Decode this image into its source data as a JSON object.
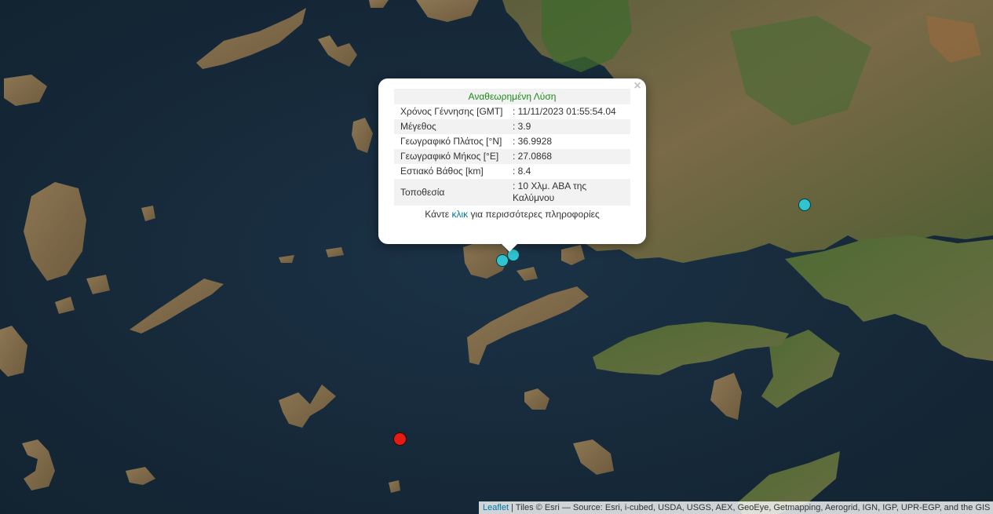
{
  "popup": {
    "heading": "Αναθεωρημένη Λύση",
    "close_symbol": "×",
    "rows": [
      {
        "label": "Χρόνος Γέννησης [GMT]",
        "value": ": 11/11/2023 01:55:54.04"
      },
      {
        "label": "Μέγεθος",
        "value": ": 3.9"
      },
      {
        "label": "Γεωγραφικό Πλάτος [°N]",
        "value": ": 36.9928"
      },
      {
        "label": "Γεωγραφικό Μήκος [°E]",
        "value": ": 27.0868"
      },
      {
        "label": "Εστιακό Βάθος [km]",
        "value": ": 8.4"
      },
      {
        "label": "Τοποθεσία",
        "value": ": 10 Χλμ. ΑΒΑ της Καλύμνου"
      }
    ],
    "footer_prefix": "Κάντε ",
    "footer_link": "κλικ",
    "footer_suffix": " για περισσότερες πληροφορίες"
  },
  "markers": [
    {
      "kind": "earthquake-recent",
      "color": "#2fc4cf"
    },
    {
      "kind": "earthquake-recent",
      "color": "#2fc4cf"
    },
    {
      "kind": "earthquake-recent",
      "color": "#2fc4cf"
    },
    {
      "kind": "earthquake-latest",
      "color": "#e21b14"
    }
  ],
  "attribution": {
    "leaflet_link": "Leaflet",
    "text": " | Tiles © Esri — Source: Esri, i-cubed, USDA, USGS, AEX, GeoEye, Getmapping, Aerogrid, IGN, IGP, UPR-EGP, and the GIS User Community"
  },
  "colors": {
    "sea": "#15293a",
    "land": "#7a6a48",
    "vegetation": "#3f5a2c",
    "heading": "#1a8a1a",
    "link": "#0078a8"
  }
}
